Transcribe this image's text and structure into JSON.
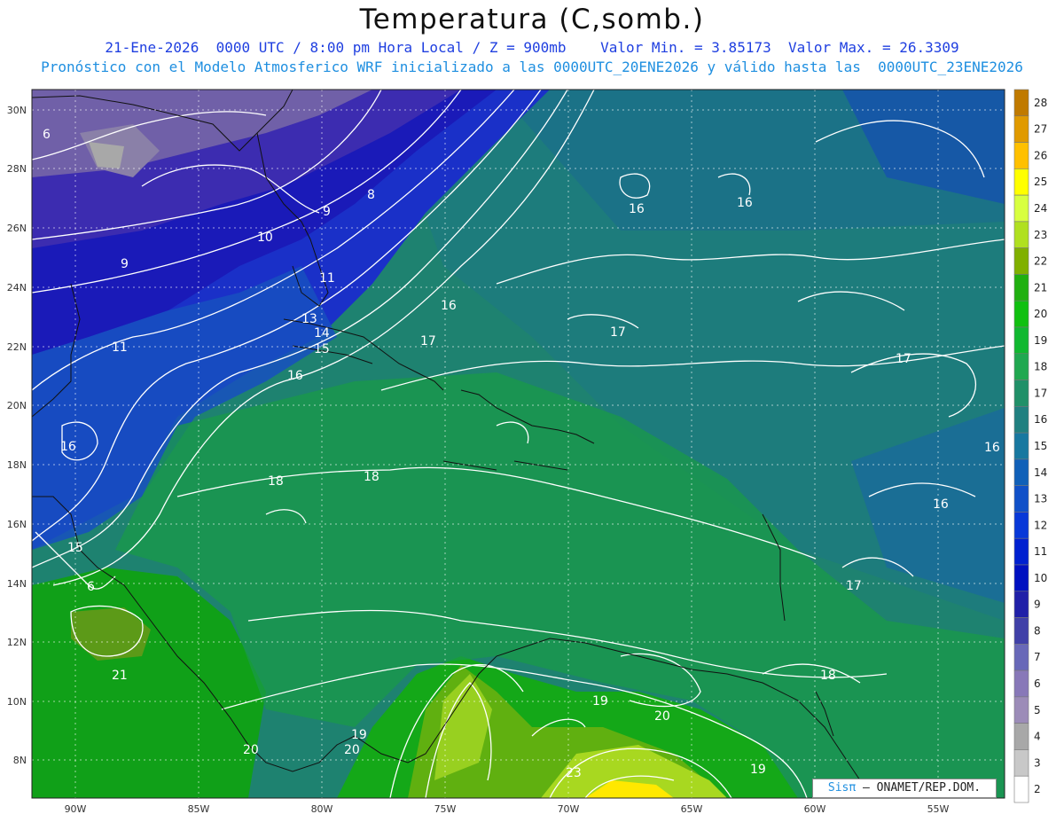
{
  "header": {
    "title": "Temperatura (C,somb.)",
    "subtitle_line1": "21-Ene-2026  0000 UTC / 8:00 pm Hora Local / Z = 900mb    Valor Min. = 3.85173  Valor Max. = 26.3309",
    "subtitle_line2": "Pronóstico con el Modelo Atmosferico WRF inicializado a las 0000UTC_20ENE2026 y válido hasta las  0000UTC_23ENE2026"
  },
  "map": {
    "lon_labels": [
      "90W",
      "85W",
      "80W",
      "75W",
      "70W",
      "65W",
      "60W",
      "55W"
    ],
    "lat_labels": [
      "30N",
      "28N",
      "26N",
      "24N",
      "22N",
      "20N",
      "18N",
      "16N",
      "14N",
      "12N",
      "10N",
      "8N"
    ],
    "contour_labels": [
      {
        "text": "6"
      },
      {
        "text": "8"
      },
      {
        "text": "9"
      },
      {
        "text": "9"
      },
      {
        "text": "10"
      },
      {
        "text": "11"
      },
      {
        "text": "11"
      },
      {
        "text": "13"
      },
      {
        "text": "14"
      },
      {
        "text": "15"
      },
      {
        "text": "15"
      },
      {
        "text": "16"
      },
      {
        "text": "16"
      },
      {
        "text": "16"
      },
      {
        "text": "16"
      },
      {
        "text": "16"
      },
      {
        "text": "16"
      },
      {
        "text": "6"
      },
      {
        "text": "17"
      },
      {
        "text": "17"
      },
      {
        "text": "17"
      },
      {
        "text": "17"
      },
      {
        "text": "18"
      },
      {
        "text": "18"
      },
      {
        "text": "18"
      },
      {
        "text": "19"
      },
      {
        "text": "19"
      },
      {
        "text": "19"
      },
      {
        "text": "20"
      },
      {
        "text": "20"
      },
      {
        "text": "20"
      },
      {
        "text": "21"
      },
      {
        "text": "23"
      }
    ]
  },
  "colorbar": {
    "labels": [
      "28",
      "27",
      "26",
      "25",
      "24",
      "23",
      "22",
      "21",
      "20",
      "19",
      "18",
      "17",
      "16",
      "15",
      "14",
      "13",
      "12",
      "11",
      "10",
      "9",
      "8",
      "7",
      "6",
      "5",
      "4",
      "3",
      "2"
    ],
    "colors": [
      "#c07a00",
      "#e09a00",
      "#ffc000",
      "#ffff00",
      "#d8ff40",
      "#b0e020",
      "#80b000",
      "#20b010",
      "#10c010",
      "#10b830",
      "#20a850",
      "#209068",
      "#208080",
      "#1878a0",
      "#1060b8",
      "#1050c8",
      "#0838d8",
      "#0020d0",
      "#0010c0",
      "#2020a8",
      "#4040a8",
      "#6868b8",
      "#8878b8",
      "#9c8cb8",
      "#a8a8a8",
      "#c8c8c8",
      "#ffffff"
    ]
  },
  "credit": {
    "brand": "Sisπ",
    "text": " – ONAMET/REP.DOM."
  }
}
